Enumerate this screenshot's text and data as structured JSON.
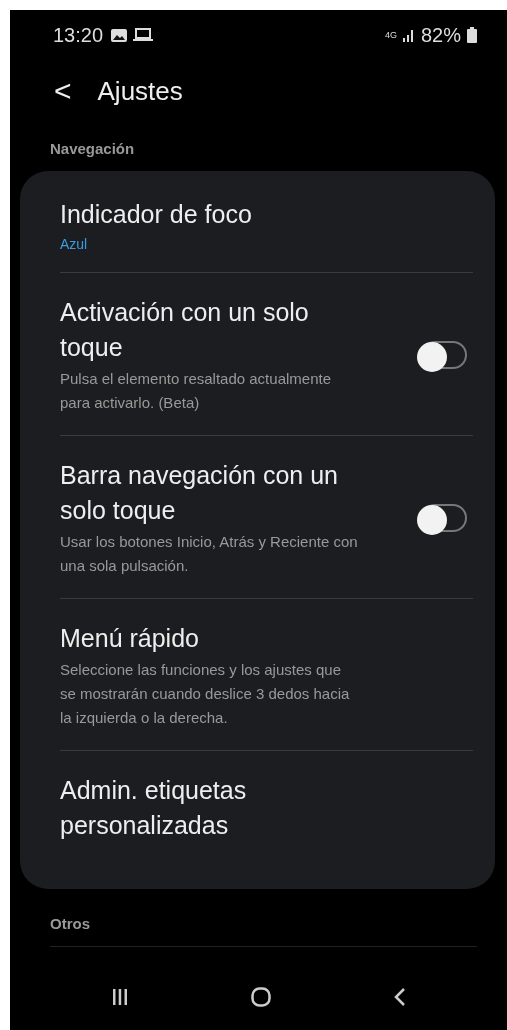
{
  "status_bar": {
    "time": "13:20",
    "network": "4G",
    "battery": "82%"
  },
  "header": {
    "back": "<",
    "title": "Ajustes"
  },
  "sections": [
    {
      "title": "Navegación",
      "items": [
        {
          "kind": "value",
          "title": "Indicador de foco",
          "value": "Azul"
        },
        {
          "kind": "toggle",
          "title": "Activación con un solo toque",
          "description": "Pulsa el elemento resaltado actualmente para activarlo. (Beta)",
          "on": false
        },
        {
          "kind": "toggle",
          "title": "Barra navegación con un solo toque",
          "description": "Usar los botones Inicio, Atrás y Reciente con una sola pulsación.",
          "on": false
        },
        {
          "kind": "text",
          "title": "Menú rápido",
          "description": "Seleccione las funciones y los ajustes que se mostrarán cuando deslice 3 dedos hacia la izquierda o la derecha."
        },
        {
          "kind": "text",
          "title": "Admin. etiquetas personalizadas"
        }
      ]
    },
    {
      "title": "Otros"
    }
  ]
}
